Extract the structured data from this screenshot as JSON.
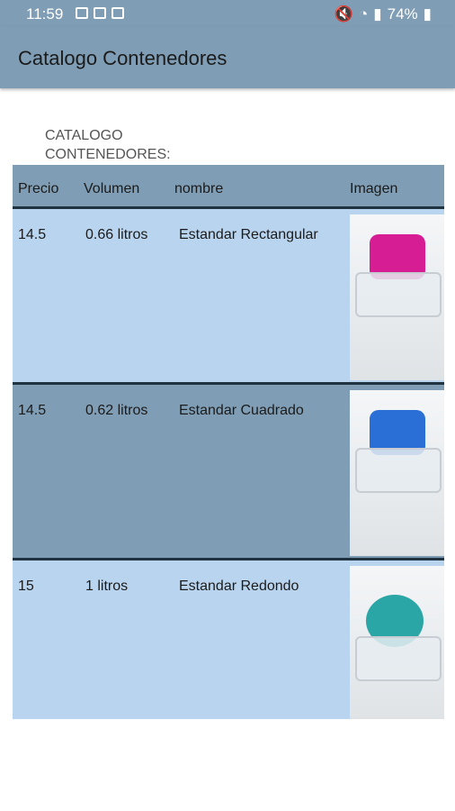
{
  "status_bar": {
    "time": "11:59",
    "battery": "74%"
  },
  "app_bar": {
    "title": "Catalogo Contenedores"
  },
  "caption": {
    "line1": "CATALOGO",
    "line2": "CONTENEDORES:"
  },
  "table": {
    "headers": [
      "Precio",
      "Volumen",
      "nombre",
      "Imagen"
    ],
    "rows": [
      {
        "precio": "14.5",
        "volumen": "0.66 litros",
        "nombre": "Estandar Rectangular",
        "image": "container-magenta-rectangular"
      },
      {
        "precio": "14.5",
        "volumen": "0.62 litros",
        "nombre": "Estandar Cuadrado",
        "image": "container-blue-square"
      },
      {
        "precio": "15",
        "volumen": "1 litros",
        "nombre": "Estandar Redondo",
        "image": "container-teal-round"
      }
    ]
  },
  "colors": {
    "bar": "#7f9db4",
    "row_light": "#b9d4ee",
    "row_dark": "#7f9db4",
    "lid_1": "#d61d93",
    "lid_2": "#2a6fd6",
    "lid_3": "#2aa6a6"
  }
}
